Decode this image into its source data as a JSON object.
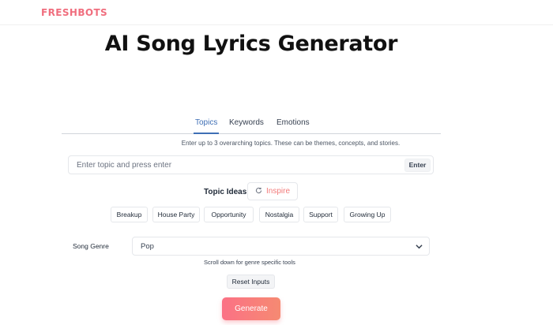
{
  "brand": {
    "logo_text": "FRESHBOTS",
    "accent_color": "#f06e7e"
  },
  "page": {
    "title": "AI Song Lyrics Generator"
  },
  "tabs": [
    {
      "label": "Topics",
      "active": true
    },
    {
      "label": "Keywords",
      "active": false
    },
    {
      "label": "Emotions",
      "active": false
    }
  ],
  "topics": {
    "hint": "Enter up to 3 overarching topics. These can be themes, concepts, and stories.",
    "input_placeholder": "Enter topic and press enter",
    "input_value": "",
    "enter_label": "Enter"
  },
  "topic_ideas": {
    "label": "Topic Ideas",
    "inspire_label": "Inspire",
    "inspire_icon": "refresh-icon",
    "chips": [
      "Breakup",
      "House Party",
      "Opportunity",
      "Nostalgia",
      "Support",
      "Growing Up"
    ]
  },
  "genre": {
    "label": "Song Genre",
    "selected": "Pop",
    "note": "Scroll down for genre specific tools"
  },
  "actions": {
    "reset_label": "Reset Inputs",
    "generate_label": "Generate",
    "generate_gradient": [
      "#fb7185",
      "#f68a72"
    ]
  }
}
